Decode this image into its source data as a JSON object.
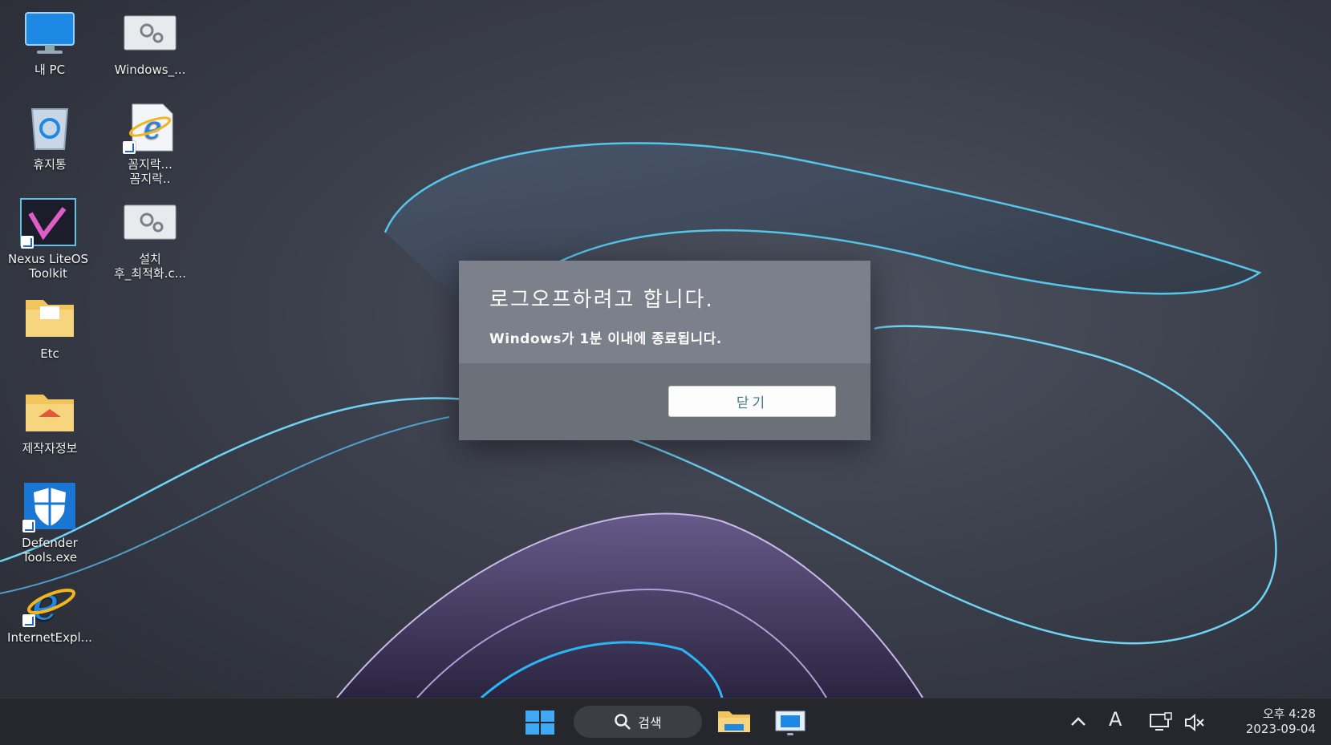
{
  "desktop": {
    "icons": [
      {
        "label": "내 PC",
        "icon": "computer-icon"
      },
      {
        "label": "Windows_...",
        "icon": "settings-script-icon"
      },
      {
        "label": "휴지통",
        "icon": "recycle-bin-icon"
      },
      {
        "label": "꼼지락...\n꼼지락..",
        "icon": "ie-document-icon"
      },
      {
        "label": "Nexus LiteOS\nToolkit",
        "icon": "nexus-toolkit-icon"
      },
      {
        "label": "설치\n후_최적화.c...",
        "icon": "settings-script-icon"
      },
      {
        "label": "Etc",
        "icon": "folder-icon"
      },
      {
        "label": "제작자정보",
        "icon": "folder-icon"
      },
      {
        "label": "Defender\nTools.exe",
        "icon": "defender-shield-icon"
      },
      {
        "label": "InternetExpl...",
        "icon": "internet-explorer-icon"
      }
    ]
  },
  "dialog": {
    "title": "로그오프하려고 합니다.",
    "message": "Windows가 1분 이내에 종료됩니다.",
    "close_label": "닫기"
  },
  "taskbar": {
    "search_label": "검색",
    "ime_label": "A",
    "time": "오후 4:28",
    "date": "2023-09-04"
  },
  "colors": {
    "accent": "#0078d4",
    "wallpaper_line": "#4fc3f7",
    "dialog_bg": "#7b808a"
  }
}
